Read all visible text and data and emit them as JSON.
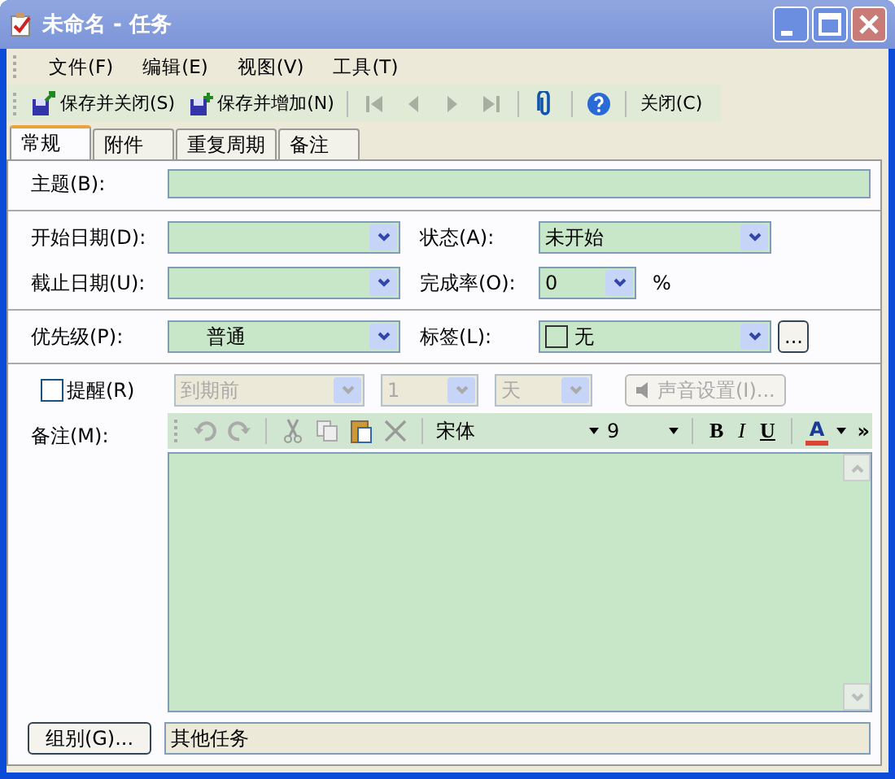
{
  "window": {
    "title": "未命名 - 任务"
  },
  "menu": [
    "文件(F)",
    "编辑(E)",
    "视图(V)",
    "工具(T)"
  ],
  "toolbar": [
    {
      "kind": "save-close",
      "label": "保存并关闭(S)",
      "disabled": false
    },
    {
      "kind": "save-new",
      "label": "保存并增加(N)",
      "disabled": false
    },
    {
      "kind": "first",
      "disabled": true
    },
    {
      "kind": "prev",
      "disabled": true
    },
    {
      "kind": "next",
      "disabled": true
    },
    {
      "kind": "last",
      "disabled": true
    },
    {
      "kind": "attach",
      "disabled": false
    },
    {
      "kind": "help",
      "disabled": false
    },
    {
      "kind": "text",
      "label": "关闭(C)",
      "disabled": false
    }
  ],
  "tabs": [
    {
      "label": "常规",
      "selected": true
    },
    {
      "label": "附件",
      "selected": false
    },
    {
      "label": "重复周期",
      "selected": false
    },
    {
      "label": "备注",
      "selected": false
    }
  ],
  "subject": {
    "label": "主题(B):"
  },
  "start_date": {
    "label": "开始日期(D):"
  },
  "due_date": {
    "label": "截止日期(U):"
  },
  "status": {
    "label": "状态(A):",
    "value": "未开始"
  },
  "percent": {
    "label": "完成率(O):",
    "value": "0",
    "unit": "%"
  },
  "priority": {
    "label": "优先级(P):",
    "value": "普通"
  },
  "tag": {
    "label": "标签(L):",
    "value": "无",
    "more": "..."
  },
  "reminder": {
    "label": "提醒(R)",
    "checked": false,
    "disabled": true,
    "when": "到期前",
    "count": "1",
    "unit": "天",
    "sound": "声音设置(I)..."
  },
  "notes": {
    "label": "备注(M):",
    "font": "宋体",
    "size": "9",
    "bold": "B",
    "italic": "I",
    "underline": "U",
    "color_letter": "A",
    "more": "»"
  },
  "group": {
    "button": "组别(G)...",
    "value": "其他任务"
  }
}
